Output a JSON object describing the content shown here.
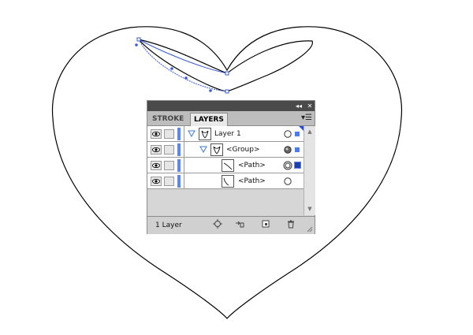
{
  "artboard": {
    "heart_stroke": "#000000",
    "selection_color": "#3b5bd6"
  },
  "layers_panel": {
    "tabs": [
      {
        "label": "STROKE",
        "active": false
      },
      {
        "label": "LAYERS",
        "active": true
      }
    ],
    "topbar_icons": [
      "collapse-icon",
      "close-icon"
    ],
    "menu_icon": "panel-menu-icon",
    "rows": [
      {
        "name": "Layer 1",
        "visible": true,
        "expanded": true,
        "targeted": false,
        "selected_marker": "small"
      },
      {
        "name": "<Group>",
        "visible": true,
        "expanded": true,
        "targeted": true,
        "selected_marker": "small"
      },
      {
        "name": "<Path>",
        "visible": true,
        "expanded": false,
        "targeted": true,
        "selected_marker": "large"
      },
      {
        "name": "<Path>",
        "visible": true,
        "expanded": false,
        "targeted": false,
        "selected_marker": "none"
      }
    ],
    "layer_color": "#5b87f2",
    "footer": {
      "count_label": "1 Layer",
      "buttons": [
        "locate-object-icon",
        "make-clipping-mask-icon",
        "new-sublayer-icon",
        "new-layer-icon",
        "delete-icon"
      ]
    }
  }
}
